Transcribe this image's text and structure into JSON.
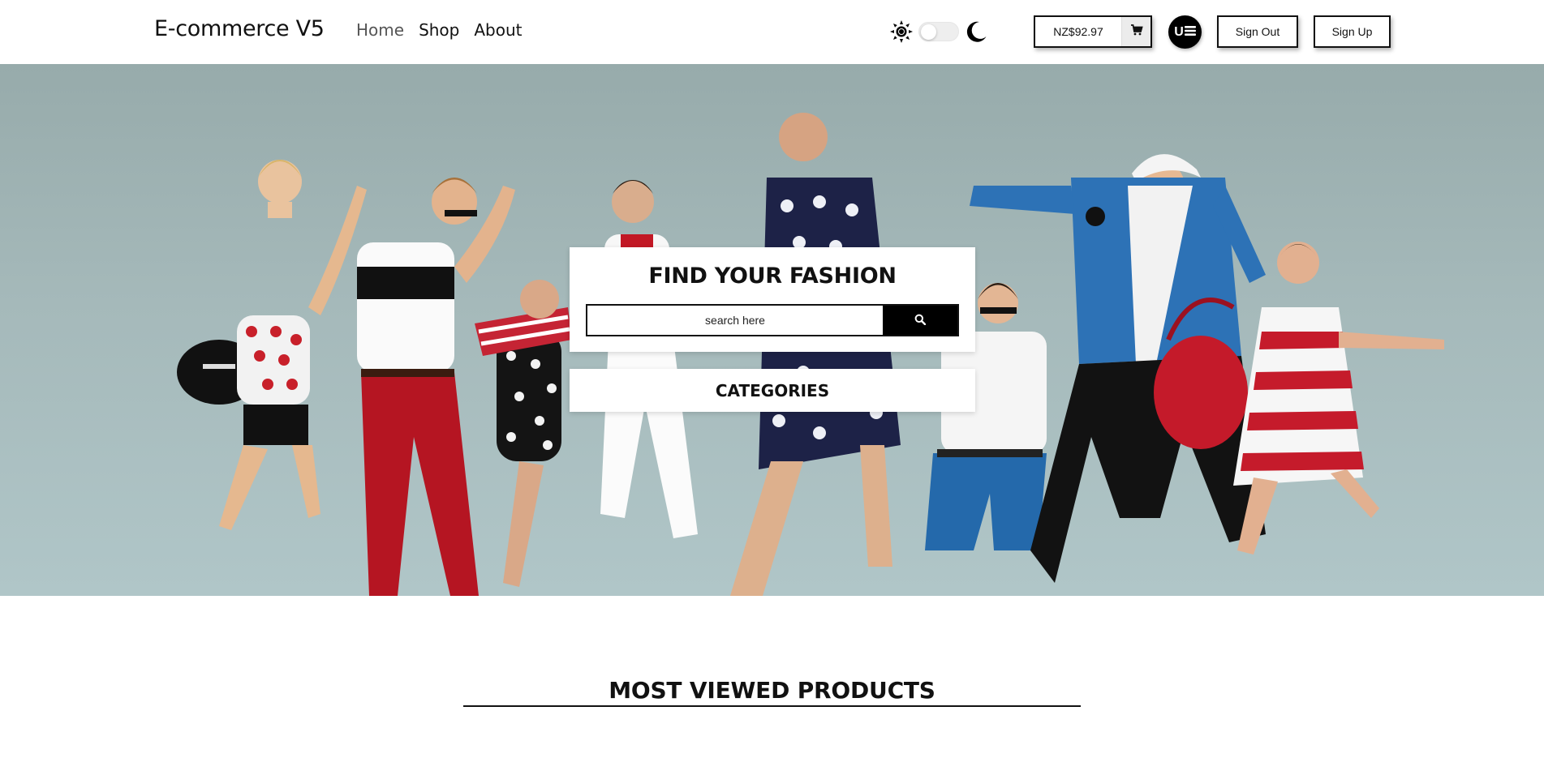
{
  "header": {
    "brand": "E-commerce V5",
    "nav": [
      {
        "label": "Home",
        "active": true
      },
      {
        "label": "Shop",
        "active": false
      },
      {
        "label": "About",
        "active": false
      }
    ],
    "theme": {
      "mode": "light",
      "light_icon": "sun-icon",
      "dark_icon": "moon-icon"
    },
    "cart": {
      "amount": "NZ$92.97",
      "icon": "cart-icon"
    },
    "user_menu": {
      "letter": "U",
      "icon": "hamburger-icon"
    },
    "sign_out_label": "Sign Out",
    "sign_up_label": "Sign Up"
  },
  "hero": {
    "search_title": "FIND YOUR FASHION",
    "search_placeholder": "search here",
    "search_icon": "search-icon",
    "categories_label": "CATEGORIES"
  },
  "sections": {
    "most_viewed_title": "MOST VIEWED PRODUCTS"
  },
  "colors": {
    "accent": "#000000",
    "hero_sky": "#a5b9ba",
    "page_bg": "#ffffff"
  }
}
